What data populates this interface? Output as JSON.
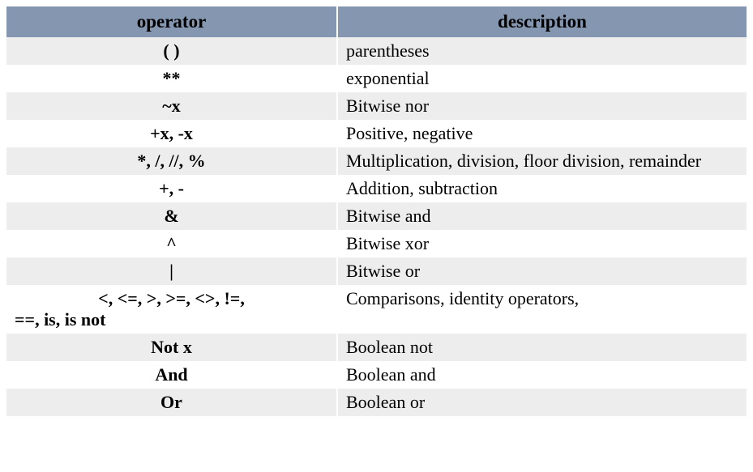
{
  "chart_data": {
    "type": "table",
    "title": "",
    "columns": [
      "operator",
      "description"
    ],
    "rows": [
      {
        "operator": "( )",
        "description": "parentheses"
      },
      {
        "operator": "**",
        "description": "exponential"
      },
      {
        "operator": "~x",
        "description": "Bitwise nor"
      },
      {
        "operator": "+x, -x",
        "description": "Positive, negative"
      },
      {
        "operator": "*, /, //, %",
        "description": "Multiplication, division, floor division, remainder"
      },
      {
        "operator": "+, -",
        "description": "Addition, subtraction"
      },
      {
        "operator": "&",
        "description": "Bitwise and"
      },
      {
        "operator": "^",
        "description": "Bitwise xor"
      },
      {
        "operator": "|",
        "description": "Bitwise or"
      },
      {
        "operator": "<, <=, >, >=, <>, !=, ==, is, is not",
        "description": "Comparisons, identity operators,"
      },
      {
        "operator": "Not x",
        "description": "Boolean not"
      },
      {
        "operator": "And",
        "description": "Boolean and"
      },
      {
        "operator": "Or",
        "description": "Boolean or"
      }
    ]
  },
  "headers": {
    "operator": "operator",
    "description": "description"
  },
  "row9_operator_line1": "<, <=, >, >=, <>, !=,",
  "row9_operator_line2": "==, is, is not"
}
